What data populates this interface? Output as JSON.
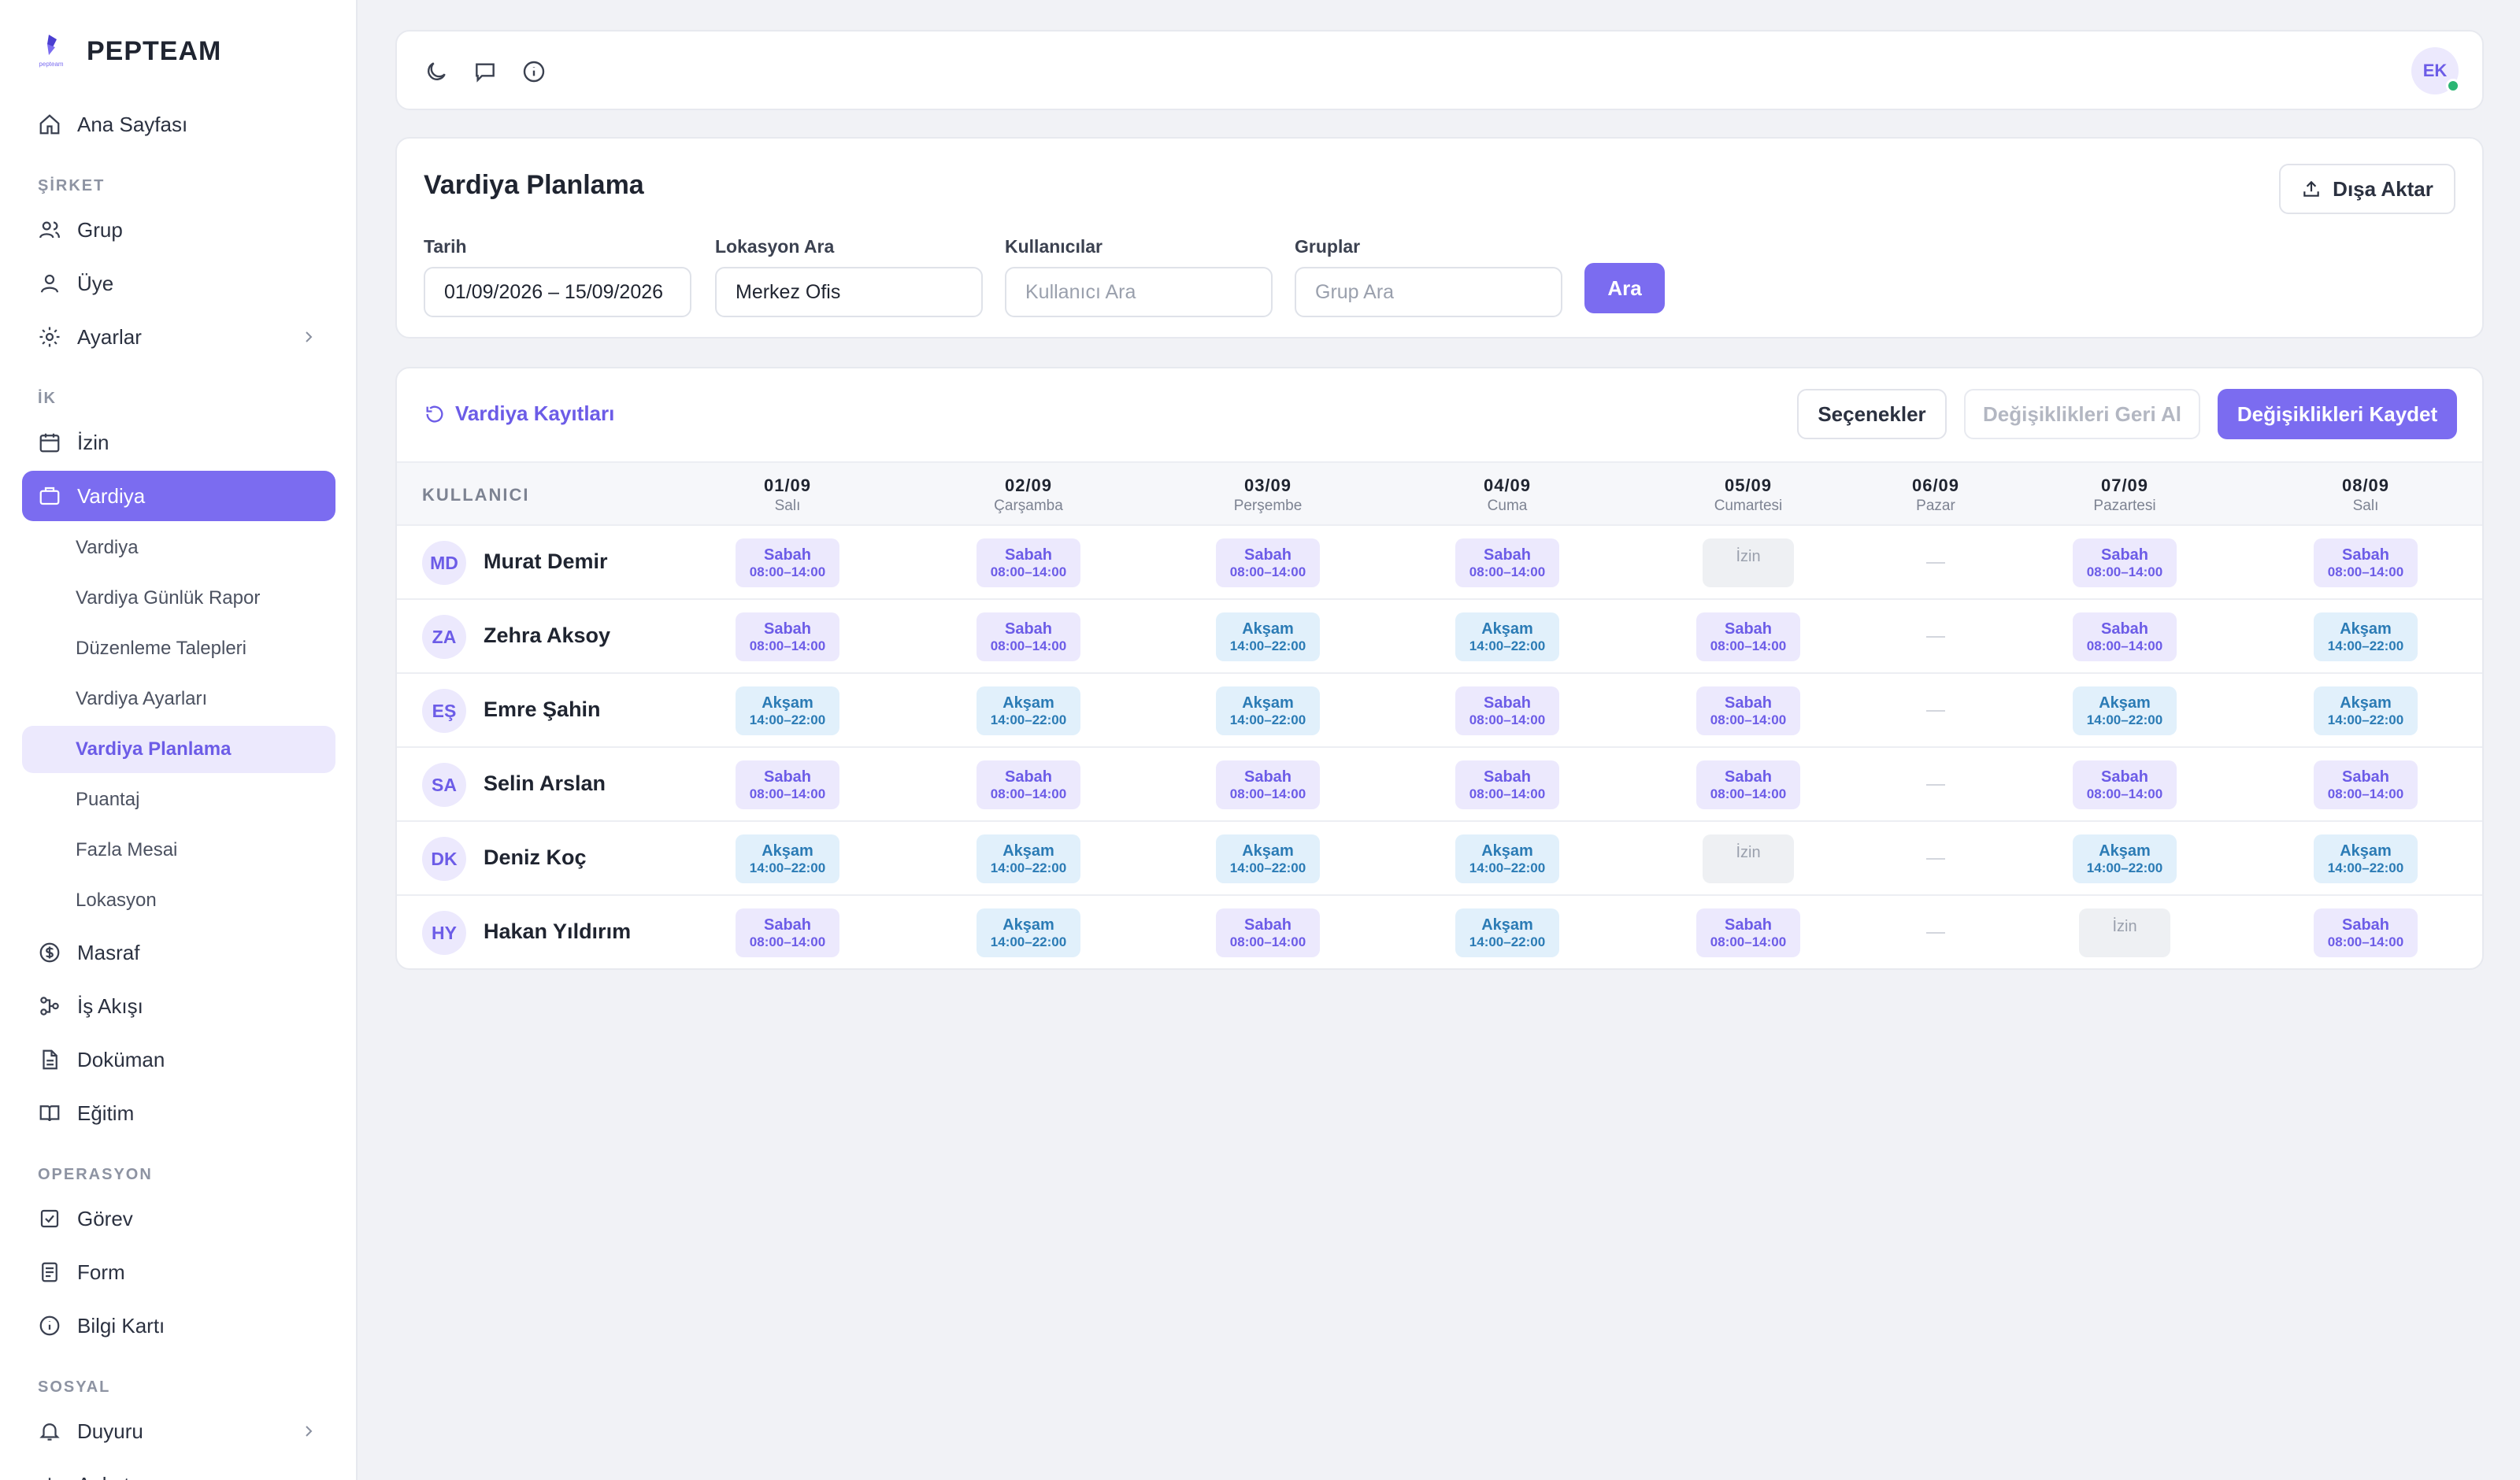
{
  "brand": {
    "name": "PEPTEAM",
    "logo_caption": "pepteam",
    "accent": "#7b6cf0"
  },
  "sidebar": {
    "home": "Ana Sayfası",
    "sections": {
      "sirket": "ŞİRKET",
      "ik": "İK",
      "operasyon": "OPERASYON",
      "sosyal": "SOSYAL"
    },
    "sirket_items": [
      "Grup",
      "Üye",
      "Ayarlar"
    ],
    "ik_items": [
      "İzin",
      "Vardiya"
    ],
    "vardiya_sub": [
      "Vardiya",
      "Vardiya Günlük Rapor",
      "Düzenleme Talepleri",
      "Vardiya Ayarları",
      "Vardiya Planlama",
      "Puantaj",
      "Fazla Mesai",
      "Lokasyon"
    ],
    "ik_items_after": [
      "Masraf",
      "İş Akışı",
      "Doküman",
      "Eğitim"
    ],
    "operasyon_items": [
      "Görev",
      "Form",
      "Bilgi Kartı"
    ],
    "sosyal_items": [
      "Duyuru",
      "Anket"
    ]
  },
  "topbar": {
    "user_initials": "EK",
    "icons": [
      "moon-icon",
      "chat-icon",
      "info-icon"
    ]
  },
  "filters": {
    "title": "Vardiya Planlama",
    "export_label": "Dışa Aktar",
    "date_label": "Tarih",
    "date_value": "01/09/2026 – 15/09/2026",
    "location_label": "Lokasyon Ara",
    "location_value": "Merkez Ofis",
    "users_label": "Kullanıcılar",
    "users_placeholder": "Kullanıcı Ara",
    "groups_label": "Gruplar",
    "groups_placeholder": "Grup Ara",
    "search_label": "Ara"
  },
  "schedule": {
    "logs_label": "Vardiya Kayıtları",
    "options_label": "Seçenekler",
    "revert_label": "Değişiklikleri Geri Al",
    "save_label": "Değişiklikleri Kaydet",
    "user_col": "KULLANICI",
    "days": [
      {
        "date": "01/09",
        "weekday": "Salı"
      },
      {
        "date": "02/09",
        "weekday": "Çarşamba"
      },
      {
        "date": "03/09",
        "weekday": "Perşembe"
      },
      {
        "date": "04/09",
        "weekday": "Cuma"
      },
      {
        "date": "05/09",
        "weekday": "Cumartesi"
      },
      {
        "date": "06/09",
        "weekday": "Pazar"
      },
      {
        "date": "07/09",
        "weekday": "Pazartesi"
      },
      {
        "date": "08/09",
        "weekday": "Salı"
      }
    ],
    "shift_types": {
      "sabah": {
        "label": "Sabah",
        "time": "08:00–14:00",
        "color": "#6c5ce7"
      },
      "aksam": {
        "label": "Akşam",
        "time": "14:00–22:00",
        "color": "#2b7bb5"
      },
      "izin": {
        "label": "İzin"
      },
      "off": {
        "label": "—"
      }
    },
    "rows": [
      {
        "initials": "MD",
        "name": "Murat Demir",
        "shifts": [
          "sabah",
          "sabah",
          "sabah",
          "sabah",
          "izin",
          "off",
          "sabah",
          "sabah"
        ]
      },
      {
        "initials": "ZA",
        "name": "Zehra Aksoy",
        "shifts": [
          "sabah",
          "sabah",
          "aksam",
          "aksam",
          "sabah",
          "off",
          "sabah",
          "aksam"
        ]
      },
      {
        "initials": "EŞ",
        "name": "Emre Şahin",
        "shifts": [
          "aksam",
          "aksam",
          "aksam",
          "sabah",
          "sabah",
          "off",
          "aksam",
          "aksam"
        ]
      },
      {
        "initials": "SA",
        "name": "Selin Arslan",
        "shifts": [
          "sabah",
          "sabah",
          "sabah",
          "sabah",
          "sabah",
          "off",
          "sabah",
          "sabah"
        ]
      },
      {
        "initials": "DK",
        "name": "Deniz Koç",
        "shifts": [
          "aksam",
          "aksam",
          "aksam",
          "aksam",
          "izin",
          "off",
          "aksam",
          "aksam"
        ]
      },
      {
        "initials": "HY",
        "name": "Hakan Yıldırım",
        "shifts": [
          "sabah",
          "aksam",
          "sabah",
          "aksam",
          "sabah",
          "off",
          "izin",
          "sabah"
        ]
      }
    ]
  }
}
